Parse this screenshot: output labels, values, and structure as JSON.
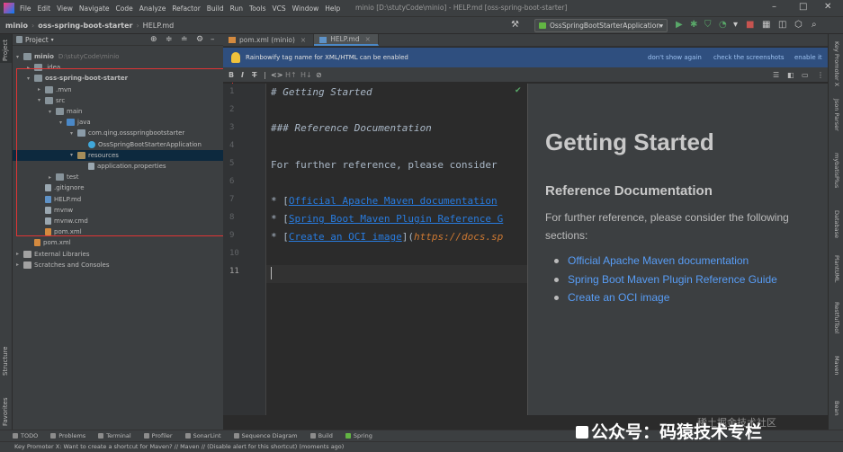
{
  "menubar": {
    "items": [
      "File",
      "Edit",
      "View",
      "Navigate",
      "Code",
      "Analyze",
      "Refactor",
      "Build",
      "Run",
      "Tools",
      "VCS",
      "Window",
      "Help"
    ],
    "title": "minio [D:\\stutyCode\\minio] - HELP.md [oss-spring-boot-starter]"
  },
  "navbar": {
    "crumbs": [
      "minio",
      "oss-spring-boot-starter",
      "HELP.md"
    ],
    "run_config": "OssSpringBootStarterApplication"
  },
  "project": {
    "header": "Project",
    "tree": [
      {
        "label": "minio",
        "extra": "D:\\stutyCode\\minio",
        "arrow": "▾",
        "icon": "folder"
      },
      {
        "label": ".idea",
        "arrow": "▸",
        "icon": "folder"
      },
      {
        "label": "oss-spring-boot-starter",
        "arrow": "▾",
        "icon": "folder"
      },
      {
        "label": ".mvn",
        "arrow": "▸",
        "icon": "folder"
      },
      {
        "label": "src",
        "arrow": "▾",
        "icon": "folder"
      },
      {
        "label": "main",
        "arrow": "▾",
        "icon": "folder"
      },
      {
        "label": "java",
        "arrow": "▾",
        "icon": "folder-src"
      },
      {
        "label": "com.qing.ossspringbootstarter",
        "arrow": "▾",
        "icon": "package"
      },
      {
        "label": "OssSpringBootStarterApplication",
        "arrow": "",
        "icon": "class"
      },
      {
        "label": "resources",
        "arrow": "▾",
        "icon": "folder-res"
      },
      {
        "label": "application.properties",
        "arrow": "",
        "icon": "file"
      },
      {
        "label": "test",
        "arrow": "▸",
        "icon": "folder"
      },
      {
        "label": ".gitignore",
        "arrow": "",
        "icon": "file"
      },
      {
        "label": "HELP.md",
        "arrow": "",
        "icon": "file-md"
      },
      {
        "label": "mvnw",
        "arrow": "",
        "icon": "file"
      },
      {
        "label": "mvnw.cmd",
        "arrow": "",
        "icon": "file"
      },
      {
        "label": "pom.xml",
        "arrow": "",
        "icon": "file-xml"
      },
      {
        "label": "pom.xml",
        "arrow": "",
        "icon": "file-xml"
      },
      {
        "label": "External Libraries",
        "arrow": "▸",
        "icon": "library"
      },
      {
        "label": "Scratches and Consoles",
        "arrow": "▸",
        "icon": "library"
      }
    ]
  },
  "left_stripe": {
    "project": "Project",
    "structure": "Structure",
    "favorites": "Favorites"
  },
  "right_stripe": [
    "Key Promoter X",
    "Json Parser",
    "mybatisPlus",
    "Database",
    "PlantUML",
    "RestfulTool",
    "Maven",
    "Bean"
  ],
  "tabs": [
    {
      "label": "pom.xml (minio)",
      "active": false
    },
    {
      "label": "HELP.md",
      "active": true
    }
  ],
  "notification": {
    "message": "Rainbowify tag name for XML/HTML can be enabled",
    "links": [
      "don't show again",
      "check the screenshots",
      "enable it"
    ]
  },
  "code": {
    "line_numbers": [
      "1",
      "2",
      "3",
      "4",
      "5",
      "6",
      "7",
      "8",
      "9",
      "10",
      "11"
    ],
    "line1": "# Getting Started",
    "line3": "### Reference Documentation",
    "line5": "For further reference, please consider",
    "bullet": "* [",
    "bullet_end": "](",
    "link1": "Official Apache Maven documentation",
    "link2": "Spring Boot Maven Plugin Reference G",
    "link3": "Create an OCI image",
    "url3": "https://docs.sp"
  },
  "preview": {
    "h1": "Getting Started",
    "h3": "Reference Documentation",
    "paragraph": "For further reference, please consider the following sections:",
    "links": [
      "Official Apache Maven documentation",
      "Spring Boot Maven Plugin Reference Guide",
      "Create an OCI image"
    ]
  },
  "toolwindows": [
    "TODO",
    "Problems",
    "Terminal",
    "Profiler",
    "SonarLint",
    "Sequence Diagram",
    "Build",
    "Spring"
  ],
  "status": "Key Promoter X: Want to create a shortcut for Maven? // Maven // (Disable alert for this shortcut) (moments ago)",
  "watermark": {
    "main": "公众号：码猿技术专栏",
    "sub": "稀土掘金技术社区"
  },
  "colors": {
    "accent": "#4a88c7",
    "highlight_box": "#e03434",
    "link": "#589df6",
    "notif_bg": "#2f4f7f"
  }
}
